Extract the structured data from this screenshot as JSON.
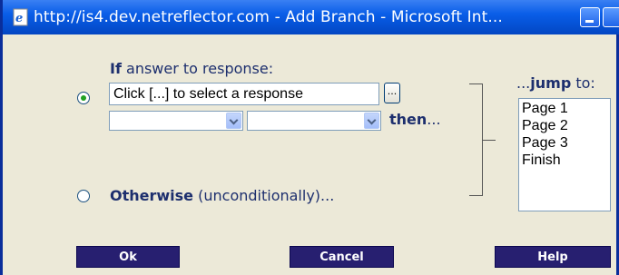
{
  "window": {
    "title": "http://is4.dev.netreflector.com - Add Branch - Microsoft Int..."
  },
  "condition": {
    "if_prefix": "If",
    "if_rest": " answer to response:",
    "response_value": "Click [...] to select a response",
    "browse_label": "...",
    "then_label": "then",
    "then_suffix": "..."
  },
  "otherwise": {
    "bold": "Otherwise",
    "rest": " (unconditionally)..."
  },
  "jump": {
    "prefix": "...",
    "bold": "jump",
    "suffix": " to:",
    "options": [
      "Page 1",
      "Page 2",
      "Page 3",
      "Finish"
    ]
  },
  "buttons": {
    "ok": "Ok",
    "cancel": "Cancel",
    "help": "Help"
  },
  "colors": {
    "titlebar": "#0552d6",
    "button_bg": "#271f70",
    "label_text": "#1d2f6e",
    "dialog_bg": "#ece9d8"
  }
}
